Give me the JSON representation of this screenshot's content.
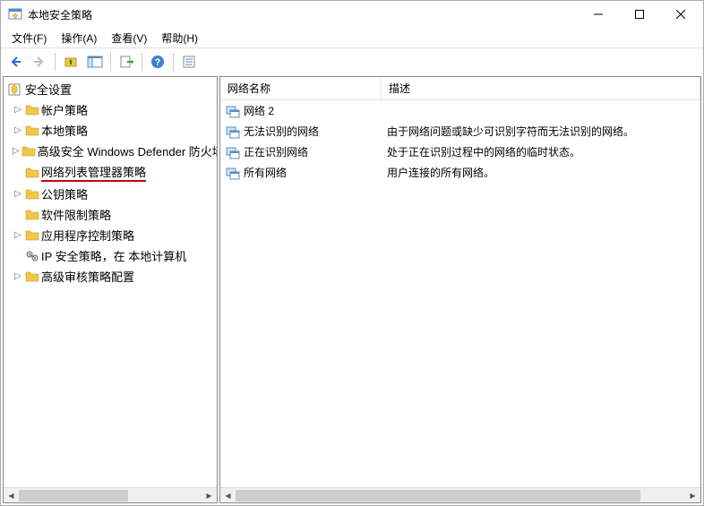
{
  "window": {
    "title": "本地安全策略"
  },
  "menu": {
    "file": "文件(F)",
    "action": "操作(A)",
    "view": "查看(V)",
    "help": "帮助(H)"
  },
  "tree": {
    "root": "安全设置",
    "items": [
      {
        "label": "帐户策略",
        "expandable": true
      },
      {
        "label": "本地策略",
        "expandable": true
      },
      {
        "label": "高级安全 Windows Defender 防火墙",
        "expandable": true
      },
      {
        "label": "网络列表管理器策略",
        "expandable": false,
        "selected": true
      },
      {
        "label": "公钥策略",
        "expandable": true
      },
      {
        "label": "软件限制策略",
        "expandable": false
      },
      {
        "label": "应用程序控制策略",
        "expandable": true
      },
      {
        "label": "IP 安全策略，在 本地计算机",
        "expandable": false,
        "ip": true
      },
      {
        "label": "高级审核策略配置",
        "expandable": true
      }
    ]
  },
  "list": {
    "col_name": "网络名称",
    "col_desc": "描述",
    "rows": [
      {
        "name": "网络 2",
        "desc": ""
      },
      {
        "name": "无法识别的网络",
        "desc": "由于网络问题或缺少可识别字符而无法识别的网络。"
      },
      {
        "name": "正在识别网络",
        "desc": "处于正在识别过程中的网络的临时状态。"
      },
      {
        "name": "所有网络",
        "desc": "用户连接的所有网络。"
      }
    ]
  }
}
